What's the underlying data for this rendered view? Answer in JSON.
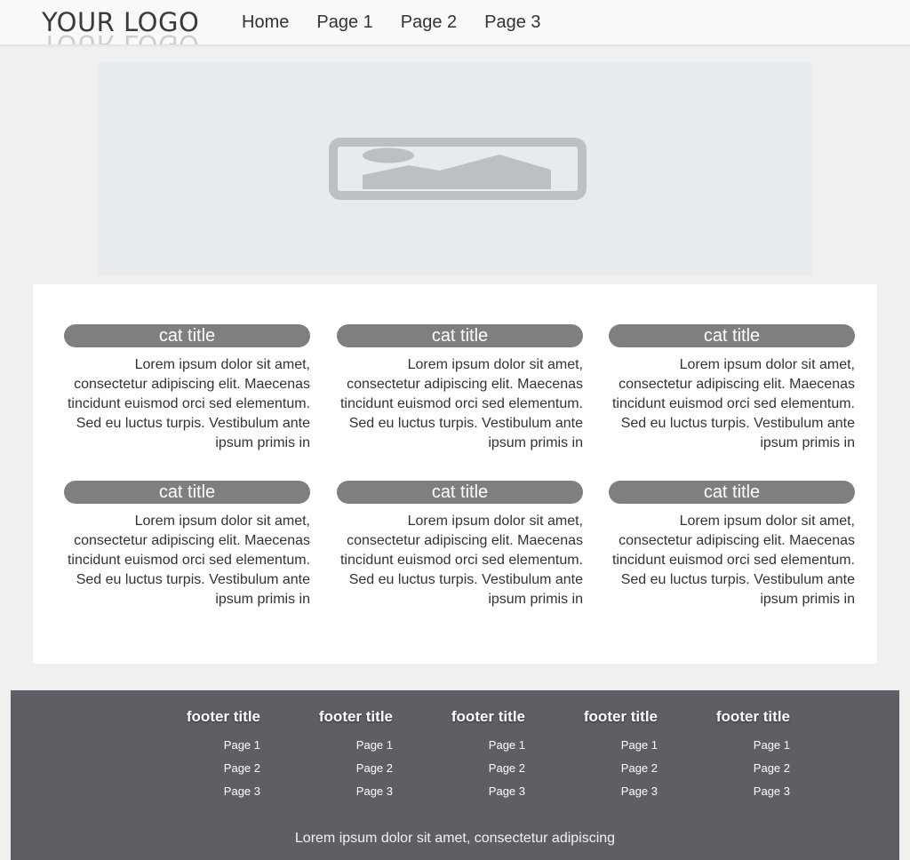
{
  "header": {
    "logo": "YOUR LOGO",
    "nav": [
      "Home",
      "Page 1",
      "Page 2",
      "Page 3"
    ]
  },
  "hero": {
    "icon": "image-placeholder-icon"
  },
  "categories": [
    {
      "title": "cat title",
      "body": "Lorem ipsum dolor sit amet, consectetur adipiscing elit. Maecenas tincidunt euismod orci sed elementum. Sed eu luctus turpis. Vestibulum ante ipsum primis in"
    },
    {
      "title": "cat title",
      "body": "Lorem ipsum dolor sit amet, consectetur adipiscing elit. Maecenas tincidunt euismod orci sed elementum. Sed eu luctus turpis. Vestibulum ante ipsum primis in"
    },
    {
      "title": "cat title",
      "body": "Lorem ipsum dolor sit amet, consectetur adipiscing elit. Maecenas tincidunt euismod orci sed elementum. Sed eu luctus turpis. Vestibulum ante ipsum primis in"
    },
    {
      "title": "cat title",
      "body": "Lorem ipsum dolor sit amet, consectetur adipiscing elit. Maecenas tincidunt euismod orci sed elementum. Sed eu luctus turpis. Vestibulum ante ipsum primis in"
    },
    {
      "title": "cat title",
      "body": "Lorem ipsum dolor sit amet, consectetur adipiscing elit. Maecenas tincidunt euismod orci sed elementum. Sed eu luctus turpis. Vestibulum ante ipsum primis in"
    },
    {
      "title": "cat title",
      "body": "Lorem ipsum dolor sit amet, consectetur adipiscing elit. Maecenas tincidunt euismod orci sed elementum. Sed eu luctus turpis. Vestibulum ante ipsum primis in"
    }
  ],
  "footer": {
    "columns": [
      {
        "title": "footer title",
        "links": [
          "Page 1",
          "Page 2",
          "Page 3"
        ]
      },
      {
        "title": "footer title",
        "links": [
          "Page 1",
          "Page 2",
          "Page 3"
        ]
      },
      {
        "title": "footer title",
        "links": [
          "Page 1",
          "Page 2",
          "Page 3"
        ]
      },
      {
        "title": "footer title",
        "links": [
          "Page 1",
          "Page 2",
          "Page 3"
        ]
      },
      {
        "title": "footer title",
        "links": [
          "Page 1",
          "Page 2",
          "Page 3"
        ]
      }
    ],
    "note": "Lorem ipsum dolor sit amet, consectetur adipiscing"
  },
  "colors": {
    "page_bg": "#f0f0f0",
    "hero_bg": "#e7ebee",
    "cat_title_bg": "#7f7f7f",
    "footer_bg": "#5e5f64"
  }
}
